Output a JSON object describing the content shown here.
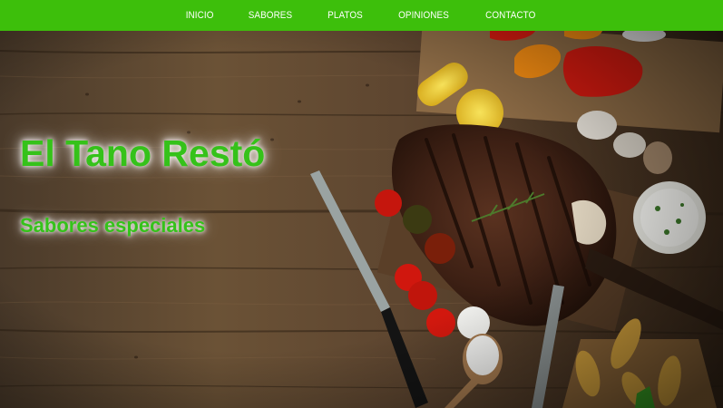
{
  "nav": {
    "items": [
      {
        "label": "INICIO"
      },
      {
        "label": "SABORES"
      },
      {
        "label": "PLATOS"
      },
      {
        "label": "OPINIONES"
      },
      {
        "label": "CONTACTO"
      }
    ],
    "background": "#3dbf0b"
  },
  "hero": {
    "title": "El Tano Restó",
    "subtitle": "Sabores especiales",
    "text_color": "#35c21a"
  }
}
